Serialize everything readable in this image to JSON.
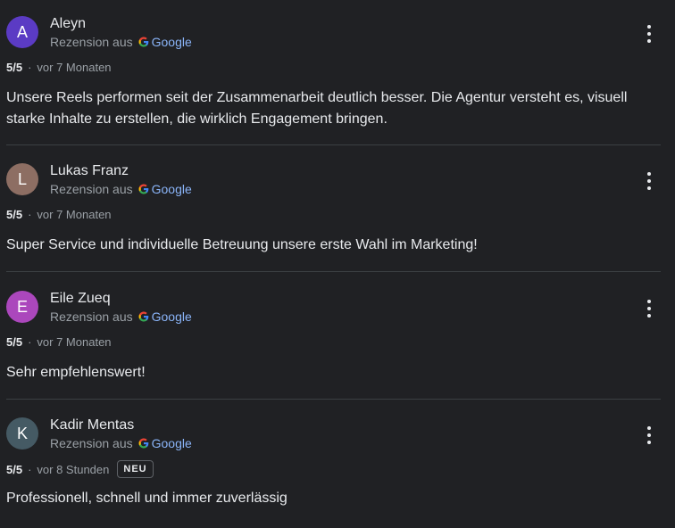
{
  "reviews": [
    {
      "avatar_letter": "A",
      "avatar_color": "#5b3bc4",
      "name": "Aleyn",
      "source_prefix": "Rezension aus",
      "source_name": "Google",
      "rating": "5/5",
      "separator": "·",
      "time": "vor 7 Monaten",
      "badge": "",
      "text": "Unsere Reels performen seit der Zusammenarbeit deutlich besser. Die Agentur versteht es, visuell starke Inhalte zu erstellen, die wirklich Engagement bringen."
    },
    {
      "avatar_letter": "L",
      "avatar_color": "#8d6e63",
      "name": "Lukas Franz",
      "source_prefix": "Rezension aus",
      "source_name": "Google",
      "rating": "5/5",
      "separator": "·",
      "time": "vor 7 Monaten",
      "badge": "",
      "text": "Super Service und individuelle Betreuung unsere erste Wahl im Marketing!"
    },
    {
      "avatar_letter": "E",
      "avatar_color": "#ab47bc",
      "name": "Eile Zueq",
      "source_prefix": "Rezension aus",
      "source_name": "Google",
      "rating": "5/5",
      "separator": "·",
      "time": "vor 7 Monaten",
      "badge": "",
      "text": "Sehr empfehlenswert!"
    },
    {
      "avatar_letter": "K",
      "avatar_color": "#455a64",
      "name": "Kadir Mentas",
      "source_prefix": "Rezension aus",
      "source_name": "Google",
      "rating": "5/5",
      "separator": "·",
      "time": "vor 8 Stunden",
      "badge": "NEU",
      "text": "Professionell, schnell und immer zuverlässig"
    }
  ],
  "icons": {
    "google": "google-g-icon",
    "more": "more-vert-icon"
  },
  "colors": {
    "background": "#202124",
    "link": "#8ab4f8",
    "divider": "#3c4043"
  }
}
